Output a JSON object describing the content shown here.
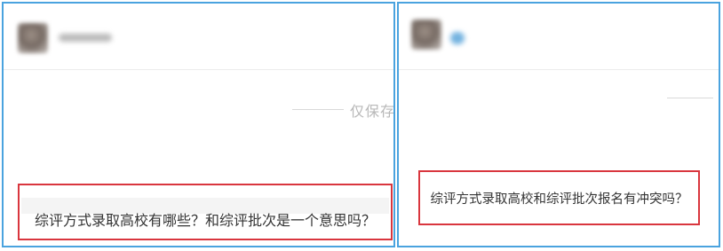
{
  "left_panel": {
    "divider_text": "仅保存",
    "question": "综评方式录取高校有哪些？和综评批次是一个意思吗？"
  },
  "right_panel": {
    "question": "综评方式录取高校和综评批次报名有冲突吗？"
  },
  "colors": {
    "panel_border": "#4aa3df",
    "highlight_border": "#d9363e",
    "text": "#333333",
    "muted_text": "#b8b8b8"
  }
}
